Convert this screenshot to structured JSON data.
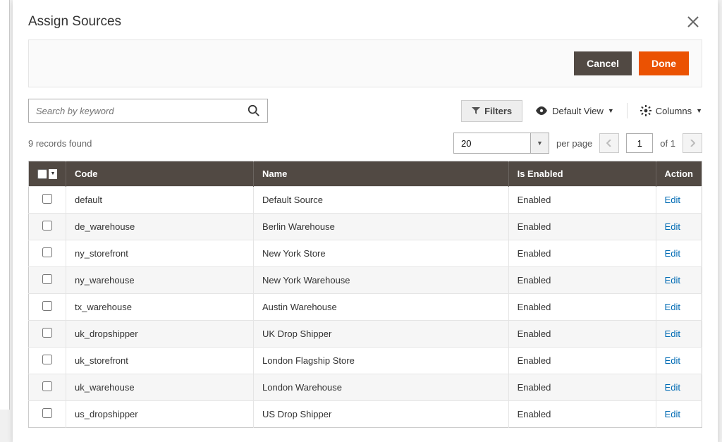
{
  "modal": {
    "title": "Assign Sources",
    "cancel_label": "Cancel",
    "done_label": "Done"
  },
  "search": {
    "placeholder": "Search by keyword"
  },
  "toolbar": {
    "filters_label": "Filters",
    "default_view_label": "Default View",
    "columns_label": "Columns"
  },
  "pager": {
    "records_found_text": "9 records found",
    "per_page_value": "20",
    "per_page_label": "per page",
    "current_page": "1",
    "of_label": "of",
    "total_pages": "1"
  },
  "grid": {
    "headers": {
      "code": "Code",
      "name": "Name",
      "enabled": "Is Enabled",
      "action": "Action"
    },
    "edit_label": "Edit",
    "rows": [
      {
        "code": "default",
        "name": "Default Source",
        "enabled": "Enabled"
      },
      {
        "code": "de_warehouse",
        "name": "Berlin Warehouse",
        "enabled": "Enabled"
      },
      {
        "code": "ny_storefront",
        "name": "New York Store",
        "enabled": "Enabled"
      },
      {
        "code": "ny_warehouse",
        "name": "New York Warehouse",
        "enabled": "Enabled"
      },
      {
        "code": "tx_warehouse",
        "name": "Austin Warehouse",
        "enabled": "Enabled"
      },
      {
        "code": "uk_dropshipper",
        "name": "UK Drop Shipper",
        "enabled": "Enabled"
      },
      {
        "code": "uk_storefront",
        "name": "London Flagship Store",
        "enabled": "Enabled"
      },
      {
        "code": "uk_warehouse",
        "name": "London Warehouse",
        "enabled": "Enabled"
      },
      {
        "code": "us_dropshipper",
        "name": "US Drop Shipper",
        "enabled": "Enabled"
      }
    ]
  }
}
